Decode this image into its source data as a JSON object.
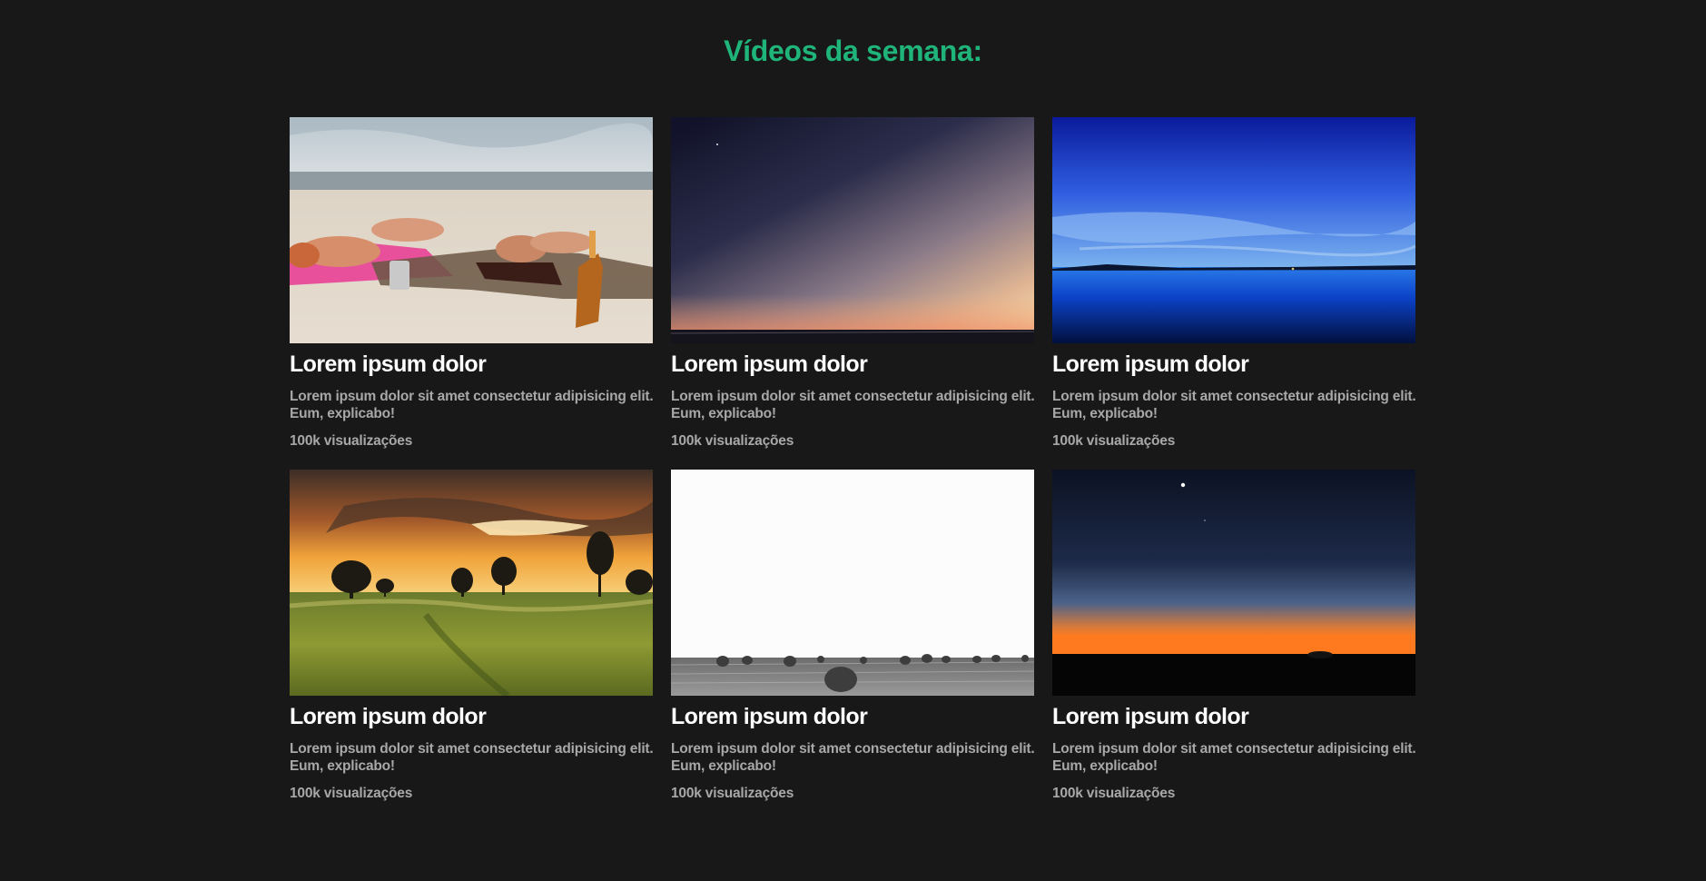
{
  "section": {
    "title": "Vídeos da semana:"
  },
  "videos": [
    {
      "thumbnail": "beach-sunbathing-photo",
      "title": "Lorem ipsum dolor",
      "description": "Lorem ipsum dolor sit amet consectetur adipisicing elit. Eum, explicabo!",
      "views": "100k visualizações"
    },
    {
      "thumbnail": "twilight-sea-photo",
      "title": "Lorem ipsum dolor",
      "description": "Lorem ipsum dolor sit amet consectetur adipisicing elit. Eum, explicabo!",
      "views": "100k visualizações"
    },
    {
      "thumbnail": "blue-lake-dusk-photo",
      "title": "Lorem ipsum dolor",
      "description": "Lorem ipsum dolor sit amet consectetur adipisicing elit. Eum, explicabo!",
      "views": "100k visualizações"
    },
    {
      "thumbnail": "meadow-sunset-trees-photo",
      "title": "Lorem ipsum dolor",
      "description": "Lorem ipsum dolor sit amet consectetur adipisicing elit. Eum, explicabo!",
      "views": "100k visualizações"
    },
    {
      "thumbnail": "hay-bales-field-photo",
      "title": "Lorem ipsum dolor",
      "description": "Lorem ipsum dolor sit amet consectetur adipisicing elit. Eum, explicabo!",
      "views": "100k visualizações"
    },
    {
      "thumbnail": "night-horizon-glow-photo",
      "title": "Lorem ipsum dolor",
      "description": "Lorem ipsum dolor sit amet consectetur adipisicing elit. Eum, explicabo!",
      "views": "100k visualizações"
    }
  ],
  "colors": {
    "background": "#181818",
    "accent": "#1fb57a",
    "title_text": "#ffffff",
    "muted_text": "#a8a8a8"
  }
}
